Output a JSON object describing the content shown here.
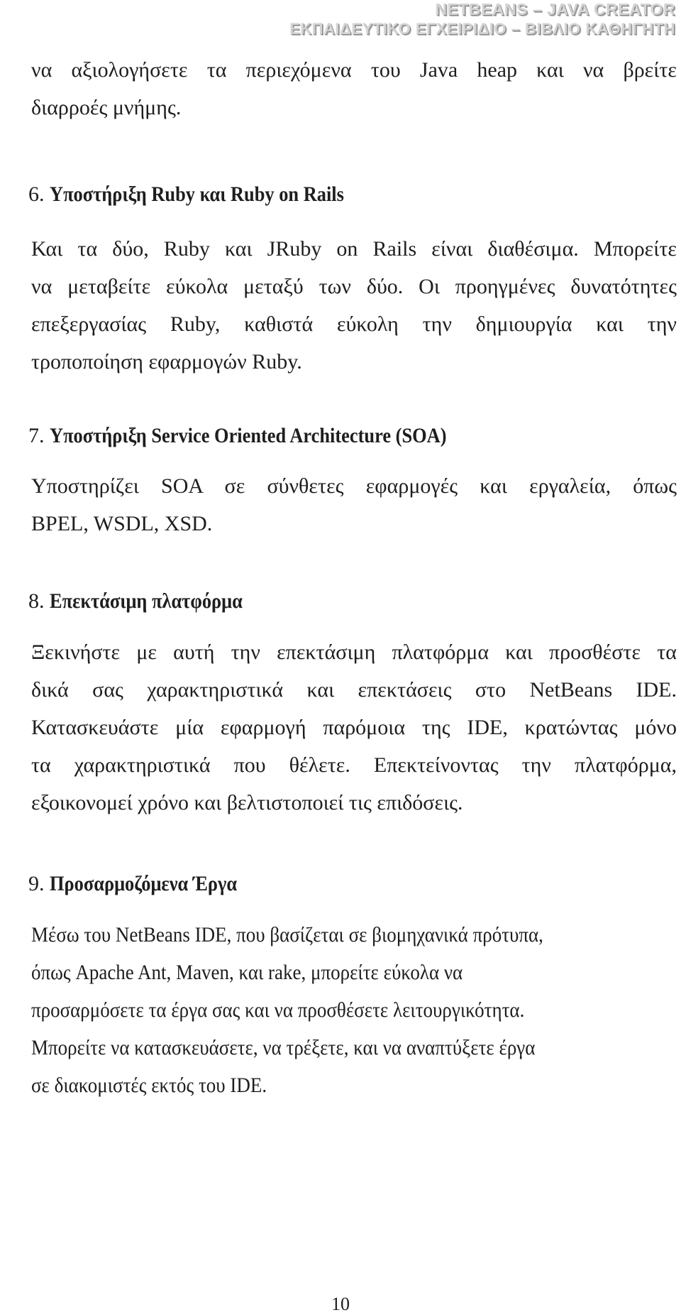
{
  "header": {
    "line1": "NETBEANS – JAVA CREATOR",
    "line2": "ΕΚΠΑΙΔΕΥΤΙΚΟ ΕΓΧΕΙΡΙΔΙΟ – ΒΙΒΛΙΟ ΚΑΘΗΓΗΤΗ"
  },
  "intro": {
    "lines": [
      "να αξιολογήσετε τα περιεχόμενα του Java heap και να βρείτε",
      "διαρροές μνήμης."
    ]
  },
  "sections": [
    {
      "number": "6.",
      "title": "Υποστήριξη Ruby και Ruby on Rails",
      "lines": [
        " Και τα δύο, Ruby και JRuby on Rails είναι διαθέσιμα.  Μπορείτε",
        "να μεταβείτε εύκολα μεταξύ των δύο.  Οι προηγμένες δυνατότητες",
        "επεξεργασίας Ruby, καθιστά εύκολη την δημιουργία και την",
        "τροποποίηση εφαρμογών Ruby."
      ]
    },
    {
      "number": "7.",
      "title": "Υποστήριξη Service Oriented Architecture (SOA)",
      "lines": [
        " Υποστηρίζει SOA σε σύνθετες εφαρμογές και εργαλεία, όπως",
        "BPEL, WSDL, XSD."
      ]
    },
    {
      "number": "8.",
      "title": "Επεκτάσιμη πλατφόρμα",
      "lines": [
        "Ξεκινήστε με αυτή την επεκτάσιμη πλατφόρμα και προσθέστε τα",
        "δικά σας χαρακτηριστικά και επεκτάσεις στο NetBeans IDE.",
        "Κατασκευάστε μία εφαρμογή παρόμοια της IDE, κρατώντας μόνο",
        "τα χαρακτηριστικά που θέλετε.  Επεκτείνοντας την πλατφόρμα,",
        "εξοικονομεί χρόνο και βελτιστοποιεί τις επιδόσεις."
      ]
    },
    {
      "number": "9.",
      "title": "Προσαρμοζόμενα Έργα",
      "lines": [
        "Μέσω του NetBeans IDE, που βασίζεται σε βιομηχανικά πρότυπα,",
        "όπως Apache Ant, Maven, και rake, μπορείτε εύκολα να",
        "προσαρμόσετε τα έργα σας και να προσθέσετε λειτουργικότητα.",
        "Μπορείτε να κατασκευάσετε, να τρέξετε, και να αναπτύξετε έργα",
        "σε διακομιστές εκτός του IDE."
      ]
    }
  ],
  "footer": {
    "page_number": "10"
  }
}
